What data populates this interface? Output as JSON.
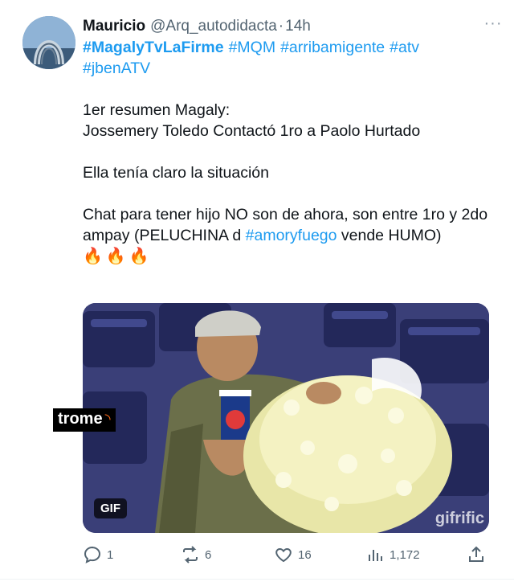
{
  "tweet": {
    "author_name": "Mauricio",
    "author_handle": "@Arq_autodidacta",
    "separator": "·",
    "time": "14h",
    "more_label": "···",
    "hashtags": [
      {
        "text": "#MagalyTvLaFirme",
        "bold": true
      },
      {
        "text": "#MQM",
        "bold": false
      },
      {
        "text": "#arribamigente",
        "bold": false
      },
      {
        "text": "#atv",
        "bold": false
      },
      {
        "text": "#jbenATV",
        "bold": false
      }
    ],
    "line1": "1er resumen Magaly:",
    "line2": "Jossemery Toledo Contactó 1ro a Paolo Hurtado",
    "line3": "Ella tenía claro la situación",
    "line4_a": "Chat para tener hijo NO son de ahora, son entre 1ro y 2do ampay (PELUCHINA d ",
    "line4_link": "#amoryfuego",
    "line4_b": " vende HUMO)",
    "emojis": "🔥🔥🔥",
    "media": {
      "badge": "GIF",
      "watermark": "gifrific",
      "brand": "trome"
    },
    "actions": {
      "replies": "1",
      "retweets": "6",
      "likes": "16",
      "views": "1,172"
    }
  },
  "colors": {
    "link": "#1d9bf0",
    "text": "#0f1419",
    "muted": "#536471"
  }
}
